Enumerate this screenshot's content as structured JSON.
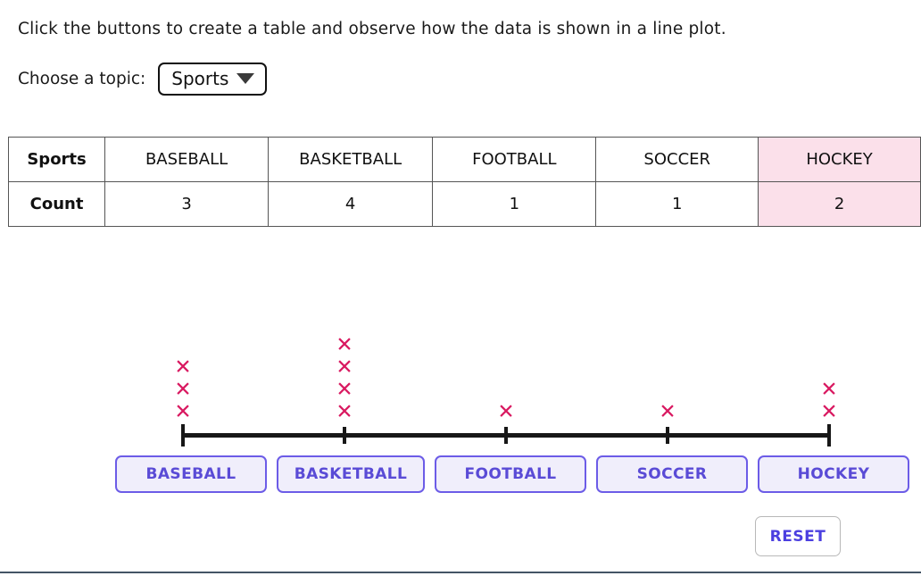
{
  "instruction": "Click the buttons to create a table and observe how the data is shown in a line plot.",
  "topic": {
    "label": "Choose a topic:",
    "selected": "Sports",
    "caret_icon": "chevron-down-icon"
  },
  "table": {
    "row_headers": [
      "Sports",
      "Count"
    ],
    "categories": [
      "BASEBALL",
      "BASKETBALL",
      "FOOTBALL",
      "SOCCER",
      "HOCKEY"
    ],
    "counts": [
      "3",
      "4",
      "1",
      "1",
      "2"
    ],
    "highlighted_category": "HOCKEY",
    "highlight_color": "#FBE0EA"
  },
  "chart_data": {
    "type": "line plot",
    "title": "",
    "xlabel": "",
    "ylabel": "",
    "categories": [
      "BASEBALL",
      "BASKETBALL",
      "FOOTBALL",
      "SOCCER",
      "HOCKEY"
    ],
    "values": [
      3,
      4,
      1,
      1,
      2
    ],
    "mark": "x",
    "mark_color": "#D91A61",
    "axis_color": "#171717",
    "grid": false,
    "legend": "none",
    "tick_count": 5
  },
  "buttons": {
    "categories": [
      "BASEBALL",
      "BASKETBALL",
      "FOOTBALL",
      "SOCCER",
      "HOCKEY"
    ],
    "reset_label": "RESET",
    "accent_color": "#6C5CE7",
    "fill_color": "#F0EEFB"
  }
}
